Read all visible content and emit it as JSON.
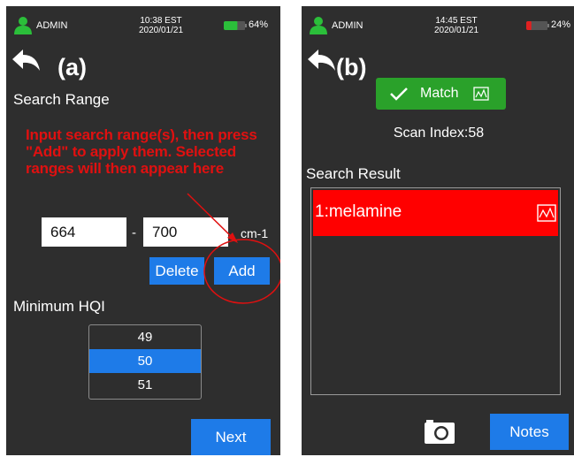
{
  "panel_a": {
    "status": {
      "user": "ADMIN",
      "time": "10:38 EST",
      "date": "2020/01/21",
      "battery": "64%",
      "battery_fraction": 0.64,
      "battery_color": "#2bbf3a"
    },
    "tag": "(a)",
    "search_range_label": "Search Range",
    "annotation": "Input search range(s), then press \"Add\" to apply them. Selected ranges will then appear here",
    "range_from": "664",
    "range_separator": "-",
    "range_to": "700",
    "unit": "cm-1",
    "delete_label": "Delete",
    "add_label": "Add",
    "min_hqi_label": "Minimum HQI",
    "hqi_options": [
      "49",
      "50",
      "51"
    ],
    "hqi_selected": "50",
    "next_label": "Next"
  },
  "panel_b": {
    "status": {
      "user": "ADMIN",
      "time": "14:45 EST",
      "date": "2020/01/21",
      "battery": "24%",
      "battery_fraction": 0.24,
      "battery_color": "#e02020"
    },
    "tag": "(b)",
    "match_label": "Match",
    "scan_index": "Scan Index:58",
    "search_result_label": "Search Result",
    "results": [
      "1:melamine"
    ],
    "notes_label": "Notes"
  },
  "colors": {
    "accent_blue": "#1e7be8",
    "match_green": "#2aa12a",
    "result_red": "#ff0000",
    "annotation_red": "#e01010",
    "screen_bg": "#2e2e2e"
  },
  "icons": [
    "user-icon",
    "battery-icon",
    "back-arrow-icon",
    "check-icon",
    "spectrum-icon",
    "camera-icon"
  ]
}
